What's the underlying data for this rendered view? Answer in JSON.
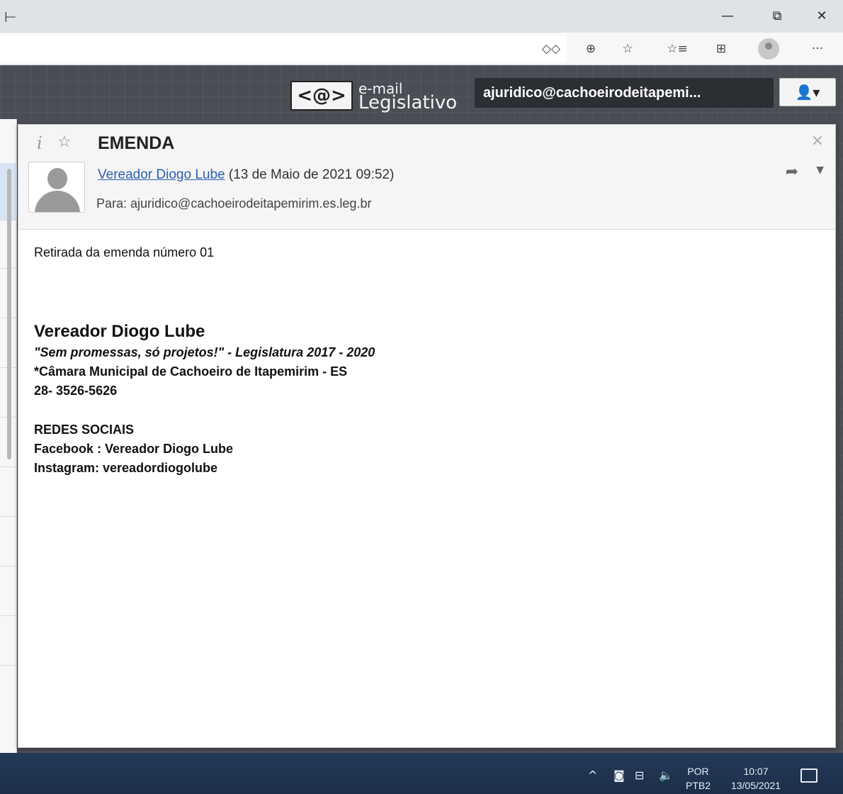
{
  "titlebar": {
    "tab_stub": "⊢",
    "minimize": "—",
    "restore": "⧉",
    "close": "✕"
  },
  "toolbar": {
    "icons": [
      "reader-view-icon",
      "zoom-icon",
      "add-favorite-icon",
      "favorites-icon",
      "collections-icon",
      "profile-icon",
      "more-icon"
    ],
    "reader_glyph": "◇◇",
    "zoom_glyph": "⊕",
    "add_fav_glyph": "☆",
    "fav_glyph": "☆≡",
    "collections_glyph": "⊞",
    "more_glyph": "···"
  },
  "app": {
    "logo_mark": "<@>",
    "logo_line1": "e-mail",
    "logo_line2": "Legislativo",
    "account_email": "ajuridico@cachoeirodeitapemi...",
    "account_glyph": "👤▾"
  },
  "message": {
    "subject": "EMENDA",
    "sender_name": "Vereador Diogo Lube",
    "sent_date": "(13 de Maio de 2021 09:52)",
    "to": "Para: ajuridico@cachoeirodeitapemirim.es.leg.br",
    "body": "Retirada da emenda número 01",
    "signature": {
      "name": "Vereador Diogo Lube",
      "slogan": "\"Sem promessas, só projetos!\" - Legislatura 2017 - 2020",
      "chamber": "*Câmara Municipal de Cachoeiro de Itapemirim - ES",
      "phone": "28- 3526-5626",
      "social_title": "REDES SOCIAIS",
      "facebook": "Facebook : Vereador Diogo Lube",
      "instagram": "Instagram: vereadordiogolube"
    }
  },
  "taskbar": {
    "lang_top": "POR",
    "lang_bottom": "PTB2",
    "time": "10:07",
    "date": "13/05/2021"
  }
}
